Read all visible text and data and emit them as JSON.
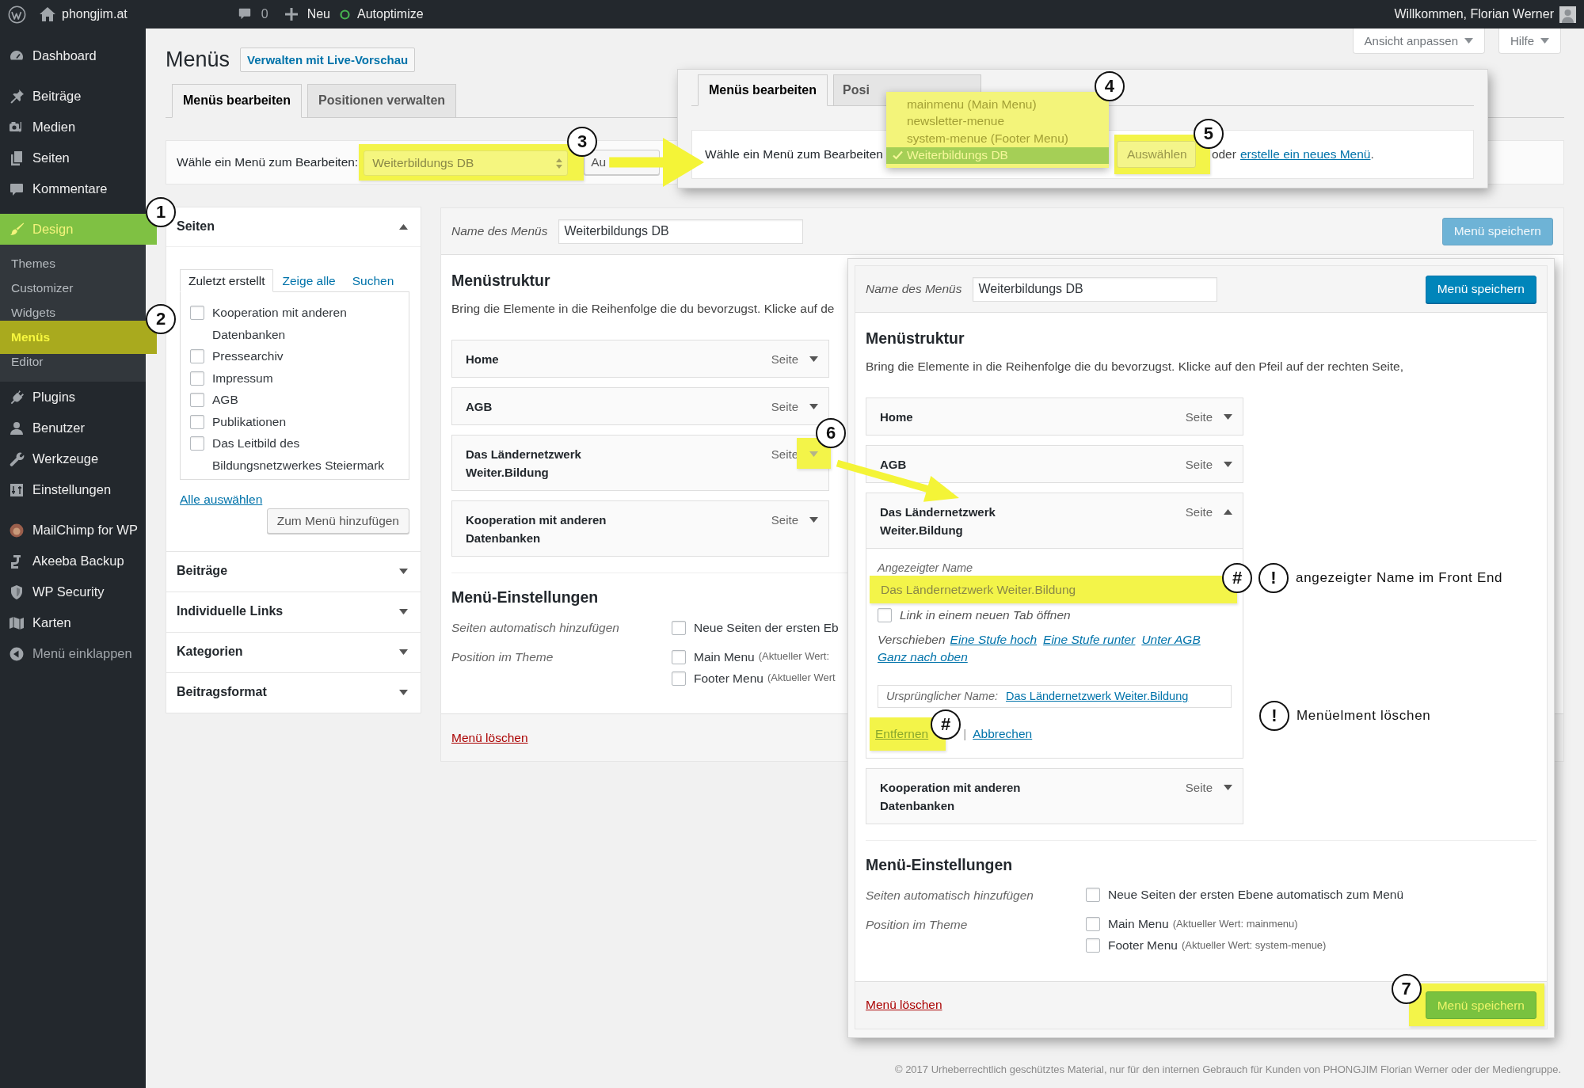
{
  "admin_bar": {
    "site": "phongjim.at",
    "comments": "0",
    "new": "Neu",
    "plugin": "Autoptimize",
    "greeting": "Willkommen, Florian Werner"
  },
  "sidebar": {
    "groups": [
      {
        "items": [
          {
            "label": "Dashboard",
            "selected": false,
            "highlighted": false
          }
        ]
      },
      {
        "items": [
          {
            "label": "Beiträge",
            "selected": false,
            "highlighted": false
          },
          {
            "label": "Medien",
            "selected": false,
            "highlighted": false
          },
          {
            "label": "Seiten",
            "selected": false,
            "highlighted": false
          },
          {
            "label": "Kommentare",
            "selected": false,
            "highlighted": false
          }
        ]
      },
      {
        "items": [
          {
            "label": "Design",
            "selected": true,
            "highlighted": true,
            "marker": "1",
            "children": [
              {
                "label": "Themes",
                "selected": false,
                "highlighted": false
              },
              {
                "label": "Customizer",
                "selected": false,
                "highlighted": false
              },
              {
                "label": "Widgets",
                "selected": false,
                "highlighted": false
              },
              {
                "label": "Menüs",
                "selected": true,
                "highlighted": true,
                "marker": "2"
              },
              {
                "label": "Editor",
                "selected": false,
                "highlighted": false
              }
            ]
          },
          {
            "label": "Plugins",
            "selected": false,
            "highlighted": false
          },
          {
            "label": "Benutzer",
            "selected": false,
            "highlighted": false
          },
          {
            "label": "Werkzeuge",
            "selected": false,
            "highlighted": false
          },
          {
            "label": "Einstellungen",
            "selected": false,
            "highlighted": false
          }
        ]
      },
      {
        "items": [
          {
            "label": "MailChimp for WP",
            "selected": false,
            "highlighted": false
          },
          {
            "label": "Akeeba Backup",
            "selected": false,
            "highlighted": false
          },
          {
            "label": "WP Security",
            "selected": false,
            "highlighted": false
          },
          {
            "label": "Karten",
            "selected": false,
            "highlighted": false
          }
        ]
      }
    ],
    "collapse": "Menü einklappen"
  },
  "screen_meta": [
    "Ansicht anpassen",
    "Hilfe"
  ],
  "header": {
    "title": "Menüs",
    "action": "Verwalten mit Live-Vorschau"
  },
  "tabs": [
    {
      "label": "Menüs bearbeiten",
      "selected": true
    },
    {
      "label": "Positionen verwalten",
      "selected": false
    }
  ],
  "menu_select": {
    "label": "Wähle ein Menü zum Bearbeiten:",
    "value": "Weiterbildungs DB",
    "highlighted": true,
    "marker": "3",
    "button": "Au"
  },
  "add_items": {
    "sections": [
      {
        "title": "Seiten",
        "expanded": true,
        "tabs": [
          {
            "label": "Zuletzt erstellt",
            "selected": true
          },
          {
            "label": "Zeige alle",
            "selected": false
          },
          {
            "label": "Suchen",
            "selected": false
          }
        ],
        "items": [
          {
            "label": "Kooperation mit anderen Datenbanken",
            "checked": false
          },
          {
            "label": "Pressearchiv",
            "checked": false
          },
          {
            "label": "Impressum",
            "checked": false
          },
          {
            "label": "AGB",
            "checked": false
          },
          {
            "label": "Publikationen",
            "checked": false
          },
          {
            "label": "Das Leitbild des Bildungsnetzwerkes Steiermark",
            "checked": false
          }
        ],
        "select_all": "Alle auswählen",
        "add_button": "Zum Menü hinzufügen"
      },
      {
        "title": "Beiträge",
        "expanded": false
      },
      {
        "title": "Individuelle Links",
        "expanded": false
      },
      {
        "title": "Kategorien",
        "expanded": false
      },
      {
        "title": "Beitragsformat",
        "expanded": false
      }
    ]
  },
  "menu_editor": {
    "name_label": "Name des Menüs",
    "name": "Weiterbildungs DB",
    "save": "Menü speichern",
    "structure_title": "Menüstruktur",
    "structure_hint": "Bring die Elemente in die Reihenfolge die du bevorzugst. Klicke auf de",
    "items": [
      {
        "title": "Home",
        "type": "Seite",
        "expanded": false,
        "toggle_highlighted": false
      },
      {
        "title": "AGB",
        "type": "Seite",
        "expanded": false,
        "toggle_highlighted": false
      },
      {
        "title": "Das Ländernetzwerk Weiter.Bildung",
        "type": "Seite",
        "expanded": false,
        "toggle_highlighted": true,
        "marker": "6"
      },
      {
        "title": "Kooperation mit anderen Datenbanken",
        "type": "Seite",
        "expanded": false,
        "toggle_highlighted": false
      }
    ],
    "settings_title": "Menü-Einstellungen",
    "settings": [
      {
        "label": "Seiten automatisch hinzufügen",
        "options": [
          {
            "label": "Neue Seiten der ersten Eb",
            "checked": false
          }
        ]
      },
      {
        "label": "Position im Theme",
        "options": [
          {
            "label": "Main Menu",
            "note": "(Aktueller Wert:",
            "checked": false
          },
          {
            "label": "Footer Menu",
            "note": "(Aktueller Wert",
            "checked": false
          }
        ]
      }
    ],
    "delete": "Menü löschen"
  },
  "inset_select": {
    "tabs": [
      {
        "label": "Menüs bearbeiten",
        "selected": true
      },
      {
        "label": "Posi",
        "selected": false
      }
    ],
    "label": "Wähle ein Menü zum Bearbeiten",
    "options": [
      {
        "label": "mainmenu (Main Menu)",
        "selected": false
      },
      {
        "label": "newsletter-menue",
        "selected": false
      },
      {
        "label": "system-menue (Footer Menu)",
        "selected": false
      },
      {
        "label": "Weiterbildungs DB",
        "selected": true
      }
    ],
    "options_highlighted": true,
    "options_marker": "4",
    "button": "Auswählen",
    "button_highlighted": true,
    "button_marker": "5",
    "or": "oder",
    "create_link": "erstelle ein neues Menü",
    "end": "."
  },
  "inset_editor": {
    "name_label": "Name des Menüs",
    "name": "Weiterbildungs DB",
    "save": "Menü speichern",
    "structure_title": "Menüstruktur",
    "structure_hint": "Bring die Elemente in die Reihenfolge die du bevorzugst. Klicke auf den Pfeil auf der rechten Seite,",
    "items": [
      {
        "title": "Home",
        "type": "Seite",
        "expanded": false
      },
      {
        "title": "AGB",
        "type": "Seite",
        "expanded": false
      },
      {
        "title": "Das Ländernetzwerk Weiter.Bildung",
        "type": "Seite",
        "expanded": true,
        "details": {
          "name_label": "Angezeigter Name",
          "name": "Das Ländernetzwerk Weiter.Bildung",
          "name_highlighted": true,
          "name_marker": "#",
          "name_note_marker": "!",
          "name_note": "angezeigter Name im Front End",
          "new_tab": "Link in einem neuen Tab öffnen",
          "new_tab_checked": false,
          "move_label": "Verschieben",
          "move_links": [
            "Eine Stufe hoch",
            "Eine Stufe runter",
            "Unter AGB",
            "Ganz nach oben"
          ],
          "original_label": "Ursprünglicher Name:",
          "original_link": "Das Ländernetzwerk Weiter.Bildung",
          "remove": "Entfernen",
          "remove_highlighted": true,
          "remove_marker": "#",
          "remove_note_marker": "!",
          "remove_note": "Menüelment löschen",
          "separator": "|",
          "cancel": "Abbrechen"
        }
      },
      {
        "title": "Kooperation mit anderen Datenbanken",
        "type": "Seite",
        "expanded": false
      }
    ],
    "settings_title": "Menü-Einstellungen",
    "settings": [
      {
        "label": "Seiten automatisch hinzufügen",
        "options": [
          {
            "label": "Neue Seiten der ersten Ebene automatisch zum Menü",
            "checked": false
          }
        ]
      },
      {
        "label": "Position im Theme",
        "options": [
          {
            "label": "Main Menu",
            "note": "(Aktueller Wert: mainmenu)",
            "checked": false
          },
          {
            "label": "Footer Menu",
            "note": "(Aktueller Wert: system-menue)",
            "checked": false
          }
        ]
      }
    ],
    "delete": "Menü löschen",
    "footer_save": {
      "label": "Menü speichern",
      "highlighted": true,
      "marker": "7"
    }
  },
  "copyright": "© 2017 Urheberrechtlich geschütztes Material, nur für den internen Gebrauch für Kunden von PHONGJIM Florian Werner oder der Mediengruppe."
}
